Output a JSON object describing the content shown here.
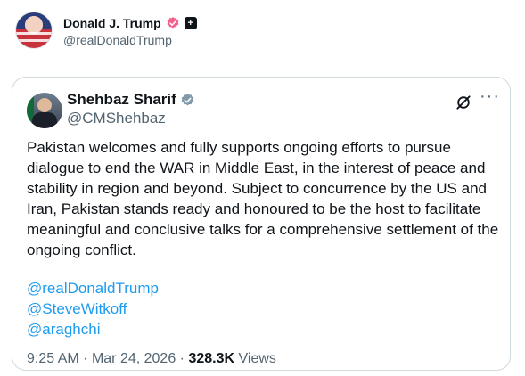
{
  "post": {
    "author_name": "Donald J. Trump",
    "author_handle": "@realDonaldTrump",
    "badge_square_glyph": "+",
    "colors": {
      "verified_badge": "#f4618e"
    }
  },
  "quote": {
    "author_name": "Shehbaz Sharif",
    "author_handle": "@CMShehbaz",
    "text": "Pakistan welcomes and fully supports ongoing efforts to pursue dialogue to end the WAR in Middle East, in the interest of peace and stability in region and beyond. Subject to concurrence by the US and Iran, Pakistan stands ready and honoured to be the host to facilitate meaningful and conclusive talks for a comprehensive settlement of the ongoing conflict.",
    "mentions": [
      "@realDonaldTrump",
      "@SteveWitkoff",
      "@araghchi"
    ],
    "time": "9:25 AM",
    "separator": "·",
    "date": "Mar 24, 2026",
    "views_count": "328.3K",
    "views_label": "Views",
    "more_glyph": "···",
    "colors": {
      "verified_badge": "#829aab",
      "link": "#1d9bf0"
    }
  }
}
